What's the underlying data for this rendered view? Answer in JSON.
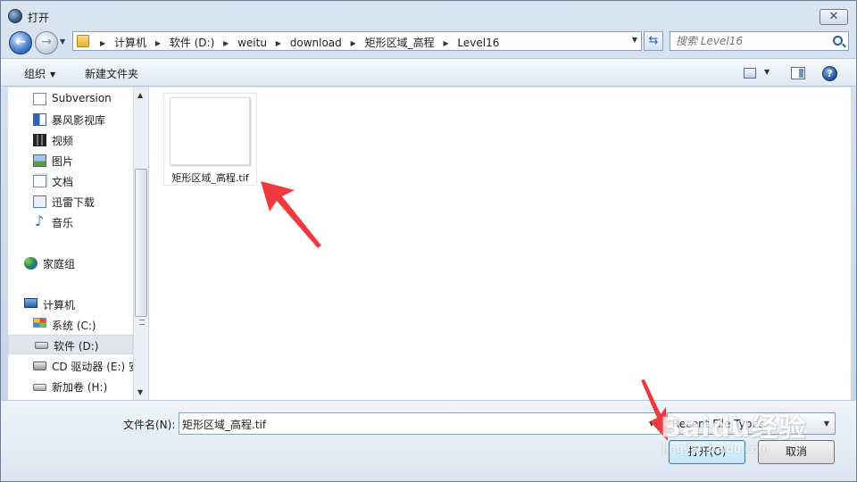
{
  "window": {
    "title": "打开",
    "close_glyph": "✕"
  },
  "address": {
    "crumbs": [
      "计算机",
      "软件 (D:)",
      "weitu",
      "download",
      "矩形区域_高程",
      "Level16"
    ]
  },
  "search": {
    "placeholder": "搜索 Level16"
  },
  "toolbar": {
    "organize_label": "组织",
    "new_folder_label": "新建文件夹",
    "help_label": "?"
  },
  "nav_pane": {
    "items": [
      {
        "label": "Subversion",
        "icon": "document-icon"
      },
      {
        "label": "暴风影视库",
        "icon": "media-library-icon"
      },
      {
        "label": "视频",
        "icon": "video-icon"
      },
      {
        "label": "图片",
        "icon": "picture-icon"
      },
      {
        "label": "文档",
        "icon": "documents-icon"
      },
      {
        "label": "迅雷下载",
        "icon": "download-icon"
      },
      {
        "label": "音乐",
        "icon": "music-icon"
      },
      {
        "label": "家庭组",
        "icon": "homegroup-icon"
      },
      {
        "label": "计算机",
        "icon": "computer-icon"
      },
      {
        "label": "系统 (C:)",
        "icon": "windows-drive-icon"
      },
      {
        "label": "软件 (D:)",
        "icon": "drive-icon",
        "selected": true
      },
      {
        "label": "CD 驱动器 (E:) 安",
        "icon": "cd-drive-icon"
      },
      {
        "label": "新加卷 (H:)",
        "icon": "drive-icon"
      }
    ]
  },
  "files": [
    {
      "name": "矩形区域_高程.tif",
      "icon": "image-file-icon"
    }
  ],
  "bottom": {
    "filename_label": "文件名(N):",
    "filename_value": "矩形区域_高程.tif",
    "file_type_value": "Recent File Types",
    "open_label": "打开(O)",
    "cancel_label": "取消"
  },
  "watermark": {
    "text": "Baidu经验",
    "sub": "jingyan.baidu.com"
  },
  "colors": {
    "arrow": "#f0383f",
    "accent": "#3c7fb1"
  }
}
